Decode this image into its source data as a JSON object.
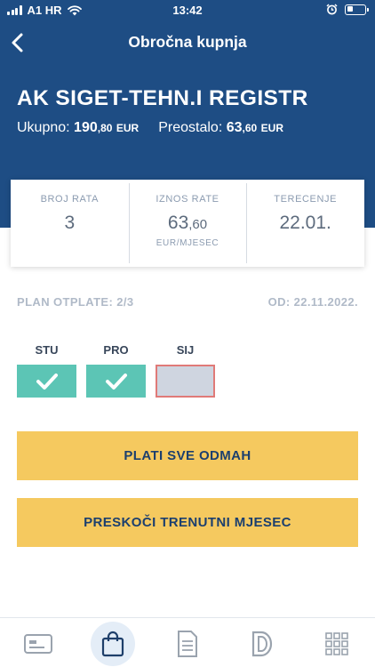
{
  "status": {
    "carrier": "A1 HR",
    "time": "13:42"
  },
  "nav": {
    "title": "Obročna kupnja",
    "back_icon": "chevron-left-icon"
  },
  "merchant": {
    "name": "AK SIGET-TEHN.I REGISTR"
  },
  "totals": {
    "total_label": "Ukupno:",
    "total_int": "190",
    "total_dec": ",80",
    "total_cur": "EUR",
    "remaining_label": "Preostalo:",
    "remaining_int": "63",
    "remaining_dec": ",60",
    "remaining_cur": "EUR"
  },
  "summary": {
    "installments_label": "BROJ RATA",
    "installments_value": "3",
    "amount_label": "IZNOS RATE",
    "amount_int": "63",
    "amount_dec": ",60",
    "amount_unit": "EUR/MJESEC",
    "charge_label": "TERECENJE",
    "charge_value": "22.01."
  },
  "plan": {
    "label": "PLAN OTPLATE: 2/3",
    "from": "OD: 22.11.2022."
  },
  "months": [
    {
      "label": "STU",
      "status": "paid"
    },
    {
      "label": "PRO",
      "status": "paid"
    },
    {
      "label": "SIJ",
      "status": "pending"
    }
  ],
  "actions": {
    "pay_all": "PLATI SVE ODMAH",
    "skip_month": "PRESKOČI TRENUTNI MJESEC"
  },
  "tabbar": {
    "items": [
      {
        "icon": "card-icon",
        "active": false
      },
      {
        "icon": "shopping-bag-icon",
        "active": true
      },
      {
        "icon": "document-icon",
        "active": false
      },
      {
        "icon": "d-logo-icon",
        "active": false
      },
      {
        "icon": "grid-icon",
        "active": false
      }
    ]
  },
  "colors": {
    "header_bg": "#1e4d84",
    "paid": "#5cc5b5",
    "pending_border": "#e07a78",
    "button": "#f5c95f",
    "text_dark": "#1c3f6e"
  }
}
